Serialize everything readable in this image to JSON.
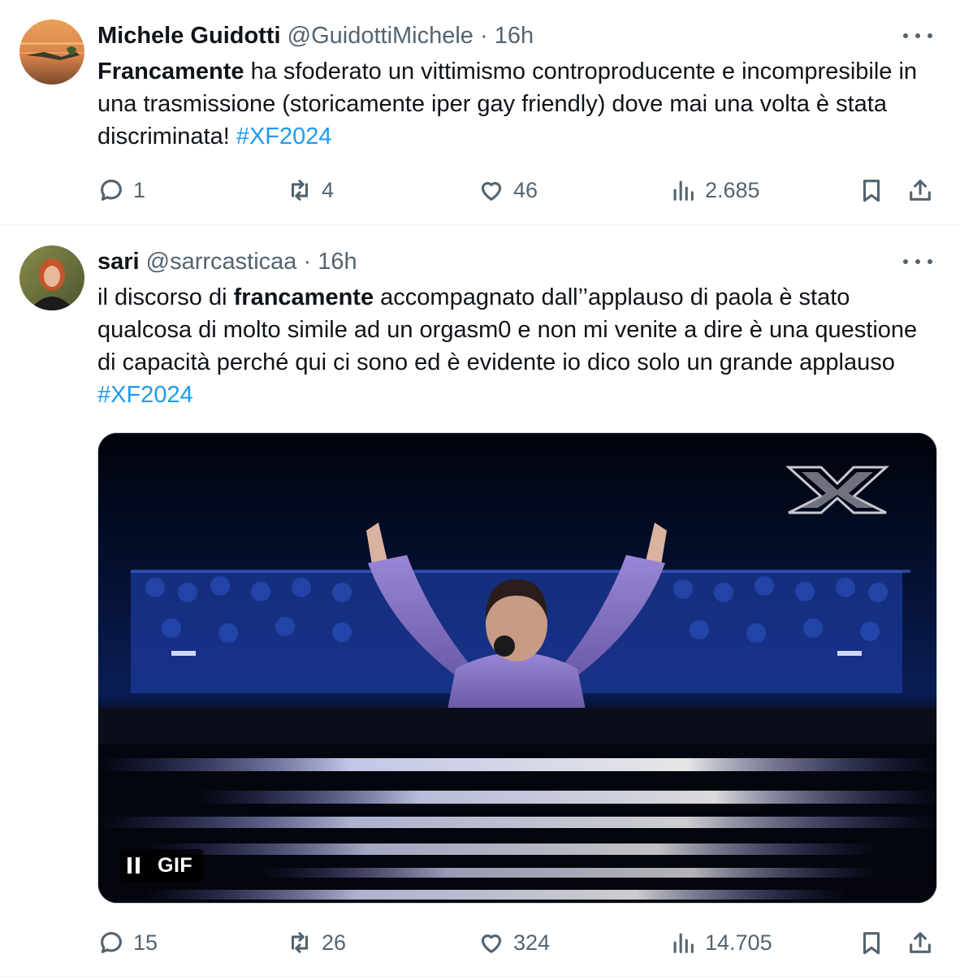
{
  "tweets": [
    {
      "display_name": "Michele Guidotti",
      "handle": "@GuidottiMichele",
      "separator": " · ",
      "time": "16h",
      "text_bold": "Francamente",
      "text_rest": " ha sfoderato un vittimismo controproducente e incompresibile in una trasmissione (storicamente iper gay friendly) dove mai una volta è stata discriminata! ",
      "hashtag": "#XF2024",
      "replies": "1",
      "reposts": "4",
      "likes": "46",
      "views": "2.685"
    },
    {
      "display_name": "sari",
      "handle": "@sarrcasticaa",
      "separator": " · ",
      "time": "16h",
      "text_pre": "il discorso di ",
      "text_bold": "francamente",
      "text_rest": " accompagnato dall’’applauso di paola è stato qualcosa di molto simile ad un orgasm0 e non mi venite a dire è una questione di capacità perché qui ci sono ed è evidente io dico solo un grande applauso ",
      "hashtag": "#XF2024",
      "media": {
        "badge": "GIF"
      },
      "replies": "15",
      "reposts": "26",
      "likes": "324",
      "views": "14.705"
    }
  ],
  "colors": {
    "text": "#0f1419",
    "secondary": "#536471",
    "link": "#1d9bf0",
    "divider": "#eff3f4"
  },
  "icons": [
    "reply-icon",
    "repost-icon",
    "like-icon",
    "views-icon",
    "bookmark-icon",
    "share-icon",
    "more-icon",
    "pause-icon"
  ]
}
